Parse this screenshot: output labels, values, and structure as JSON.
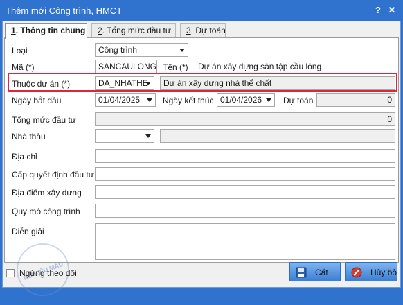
{
  "window": {
    "title": "Thêm mới Công trình, HMCT",
    "help_label": "?",
    "close_label": "✕"
  },
  "tabs": [
    {
      "key": "1",
      "label": ". Thông tin chung",
      "active": true
    },
    {
      "key": "2",
      "label": ". Tổng mức đầu tư",
      "active": false
    },
    {
      "key": "3",
      "label": ". Dự toán",
      "active": false
    }
  ],
  "form": {
    "loai": {
      "label": "Loại",
      "value": "Công trình"
    },
    "ma": {
      "label": "Mã (*)",
      "value": "SANCAULONG"
    },
    "ten": {
      "label": "Tên (*)",
      "value": "Dự án xây dựng sân tập cầu lông"
    },
    "thuoc_du_an": {
      "label": "Thuộc dự án (*)",
      "value": "DA_NHATHE",
      "name": "Dự án xây dựng nhà thể chất"
    },
    "ngay_bat_dau": {
      "label": "Ngày bắt đầu",
      "value": "01/04/2025"
    },
    "ngay_ket_thuc": {
      "label": "Ngày kết thúc",
      "value": "01/04/2026"
    },
    "du_toan": {
      "label": "Dự toán",
      "value": "0"
    },
    "tong_muc_dau_tu": {
      "label": "Tổng mức đầu tư",
      "value": "0"
    },
    "nha_thau": {
      "label": "Nhà thầu",
      "value": "",
      "name": ""
    },
    "dia_chi": {
      "label": "Địa chỉ",
      "value": ""
    },
    "cap_quyet_dinh": {
      "label": "Cấp quyết định đầu tư",
      "value": ""
    },
    "dia_diem": {
      "label": "Địa điểm xây dựng",
      "value": ""
    },
    "quy_mo": {
      "label": "Quy mô công trình",
      "value": ""
    },
    "dien_giai": {
      "label": "Diễn giải",
      "value": ""
    }
  },
  "footer": {
    "stop_tracking_label": "Ngừng theo dõi",
    "stop_tracking_checked": false,
    "save_label": "Cất",
    "cancel_label": "Hủy bỏ"
  },
  "watermark": "DỮ LIỆU MẪU",
  "colors": {
    "titlebar": "#2f73cf",
    "highlight": "#e0243a"
  }
}
